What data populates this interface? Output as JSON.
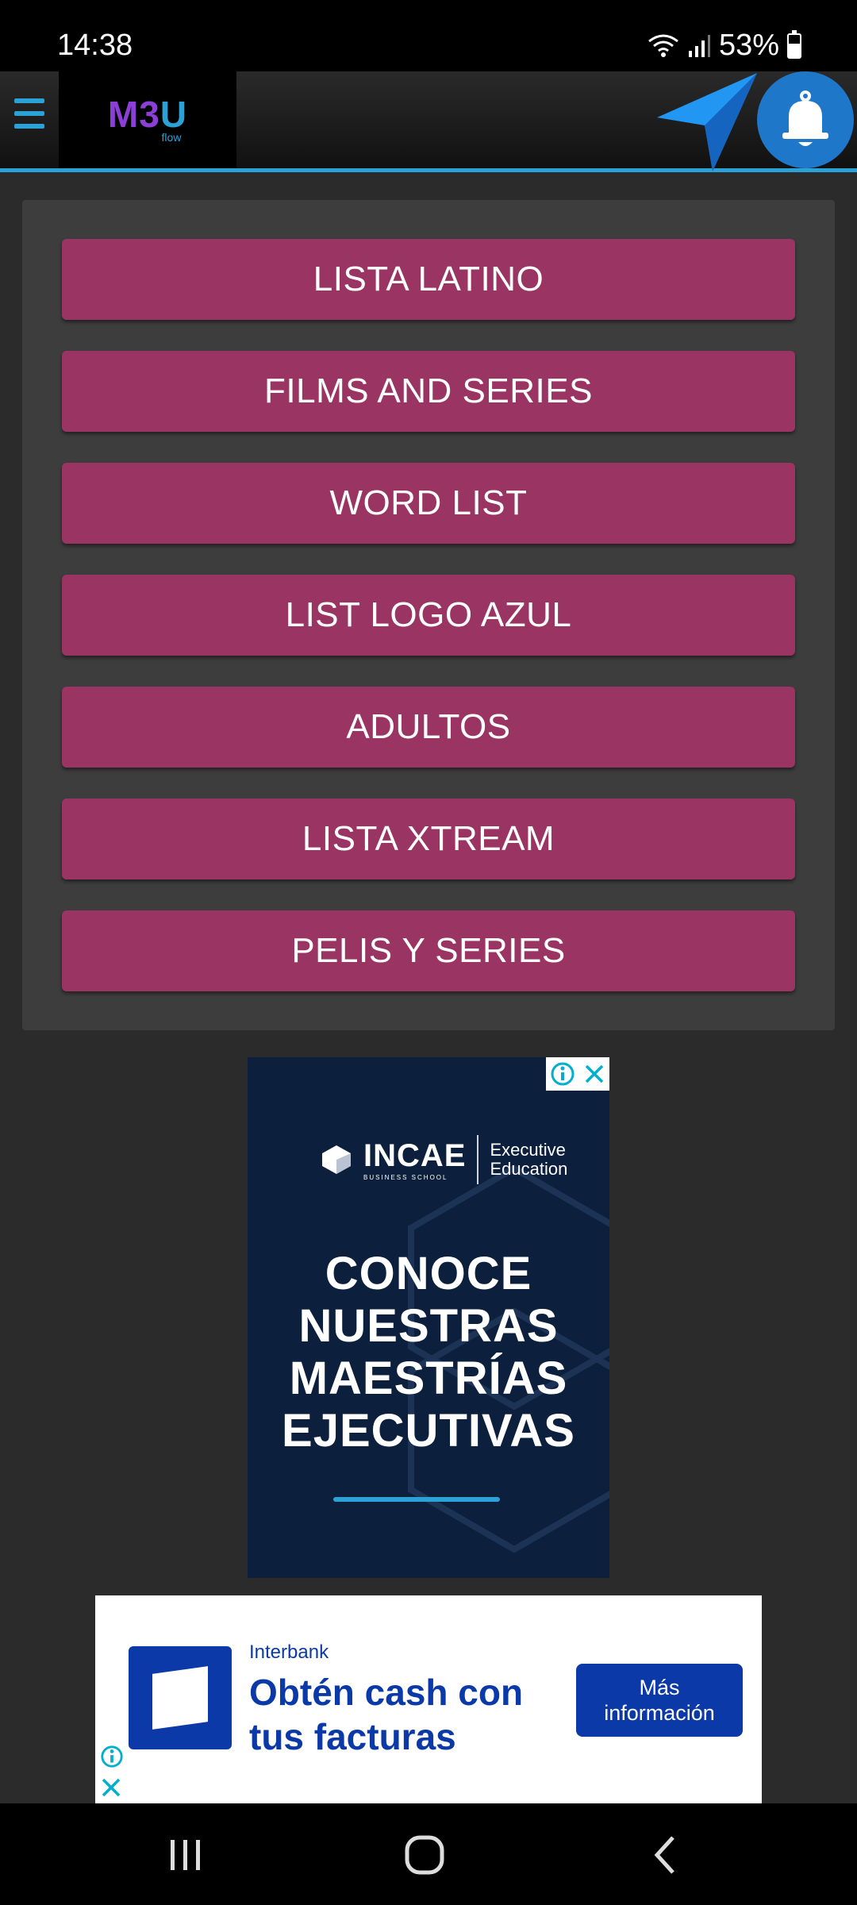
{
  "status": {
    "time": "14:38",
    "battery": "53%"
  },
  "header": {
    "logo_main": "M3",
    "logo_u": "U",
    "logo_sub": "flow",
    "icons": [
      "menu-icon",
      "send-icon",
      "bell-icon"
    ]
  },
  "lists": [
    {
      "label": "LISTA LATINO"
    },
    {
      "label": "FILMS AND SERIES"
    },
    {
      "label": "WORD LIST"
    },
    {
      "label": "LIST LOGO AZUL"
    },
    {
      "label": "ADULTOS"
    },
    {
      "label": "LISTA XTREAM"
    },
    {
      "label": "PELIS Y SERIES"
    }
  ],
  "ad_vertical": {
    "brand": "INCAE",
    "brand_sub": "BUSINESS SCHOOL",
    "exec_line1": "Executive",
    "exec_line2": "Education",
    "headline_lines": [
      "CONOCE",
      "NUESTRAS",
      "MAESTRÍAS",
      "EJECUTIVAS"
    ]
  },
  "ad_banner": {
    "brand": "Interbank",
    "headline_line1": "Obtén cash con",
    "headline_line2": "tus facturas",
    "cta_line1": "Más",
    "cta_line2": "información"
  },
  "colors": {
    "accent": "#2ca1d6",
    "button": "#9a3462",
    "panel": "#3d3d3d",
    "background": "#2b2b2b"
  }
}
